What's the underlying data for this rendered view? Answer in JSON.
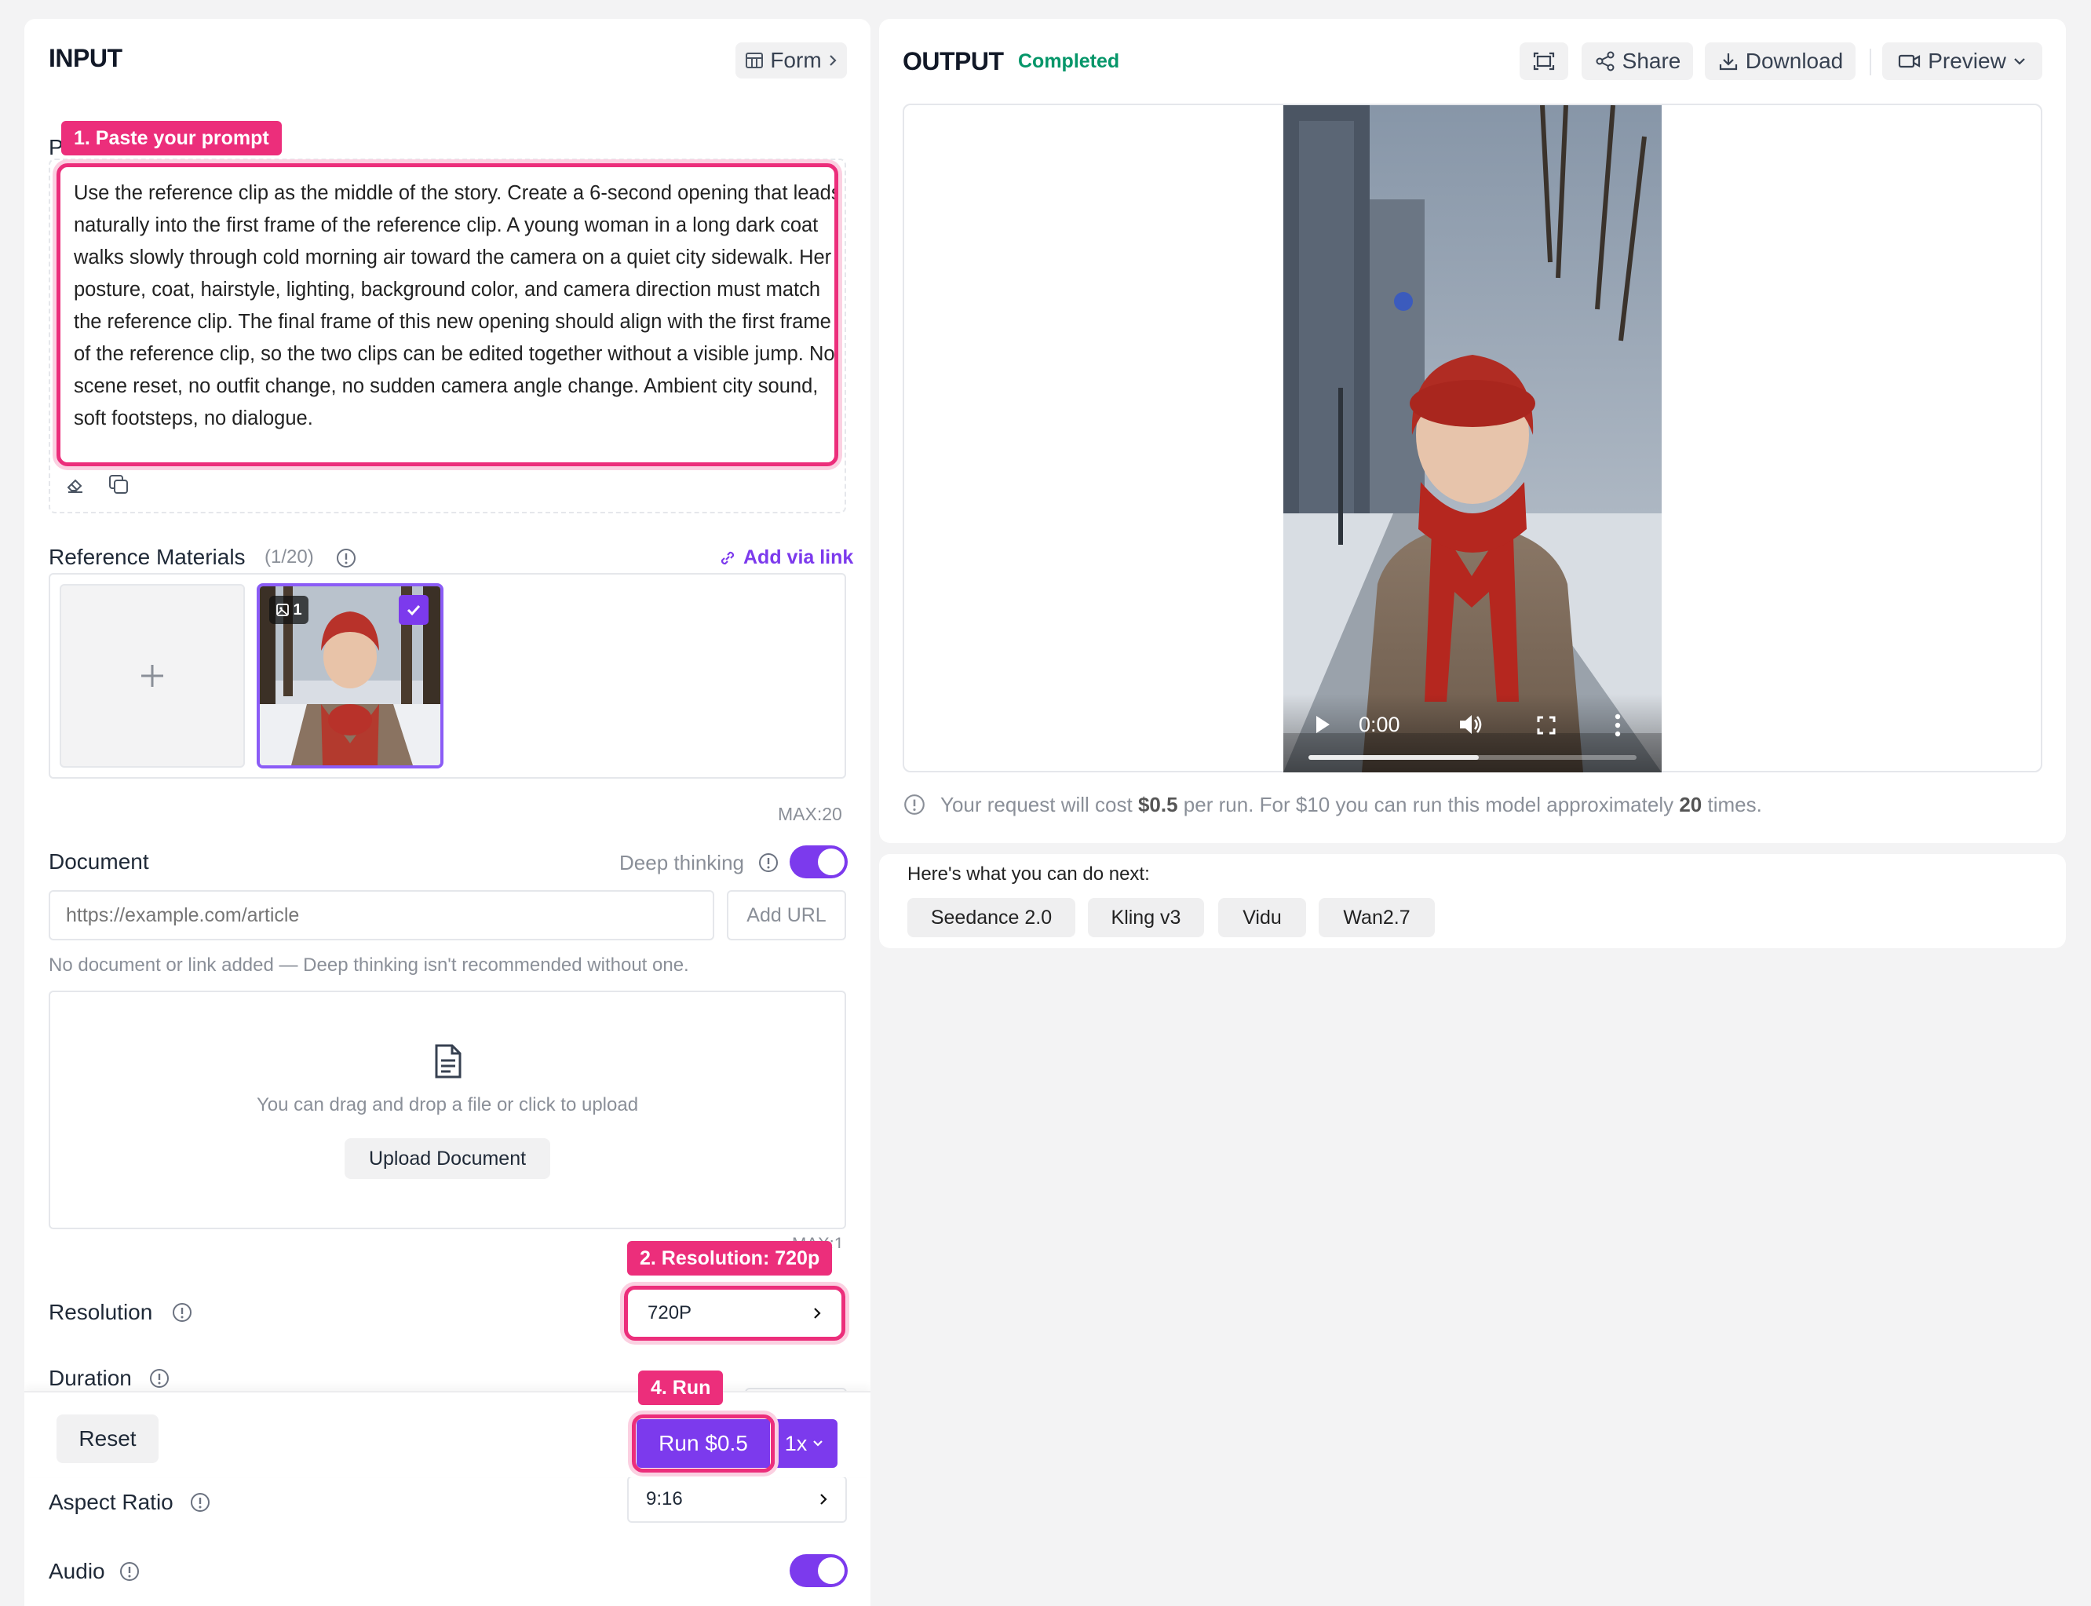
{
  "input": {
    "title": "INPUT",
    "form_label": "Form",
    "prompt_label_partial": "P",
    "prompt_text": "Use the reference clip as the middle of the story. Create a 6-second opening that leads naturally into the first frame of the reference clip. A young woman in a long dark coat walks slowly through cold morning air toward the camera on a quiet city sidewalk. Her posture, coat, hairstyle, lighting, background color, and camera direction must match the reference clip. The final frame of this new opening should align with the first frame of the reference clip, so the two clips can be edited together without a visible jump. No scene reset, no outfit change, no sudden camera angle change. Ambient city sound, soft footsteps, no dialogue.",
    "reference": {
      "label": "Reference Materials",
      "count": "(1/20)",
      "add_link": "Add via link",
      "thumb_badge": "1",
      "max": "MAX:20"
    },
    "document": {
      "label": "Document",
      "deep_thinking": "Deep thinking",
      "deep_thinking_on": true,
      "url_placeholder": "https://example.com/article",
      "add_url": "Add URL",
      "hint": "No document or link added — Deep thinking isn't recommended without one.",
      "drop_text": "You can drag and drop a file or click to upload",
      "upload_button": "Upload Document",
      "max_partial": "MAX:1"
    },
    "resolution": {
      "label": "Resolution",
      "value": "720P"
    },
    "duration": {
      "label": "Duration"
    },
    "aspect_ratio": {
      "label": "Aspect Ratio",
      "value": "9:16"
    },
    "audio": {
      "label": "Audio",
      "on": true
    },
    "footer": {
      "reset": "Reset",
      "run": "Run $0.5",
      "multiplier": "1x"
    }
  },
  "callouts": {
    "prompt": "1. Paste your prompt",
    "resolution": "2. Resolution: 720p",
    "run": "4. Run"
  },
  "output": {
    "title": "OUTPUT",
    "status": "Completed",
    "share": "Share",
    "download": "Download",
    "preview": "Preview",
    "video_time": "0:00",
    "video_progress": 0.52,
    "cost_prefix": "Your request will cost ",
    "cost_value": "$0.5",
    "cost_mid": " per run. For $10 you can run this model approximately ",
    "cost_runs": "20",
    "cost_suffix": " times."
  },
  "next": {
    "title": "Here's what you can do next:",
    "chips": [
      "Seedance 2.0",
      "Kling v3",
      "Vidu",
      "Wan2.7"
    ]
  },
  "colors": {
    "accent": "#7c3aed",
    "callout": "#ec2e7b",
    "status_green": "#059669"
  }
}
